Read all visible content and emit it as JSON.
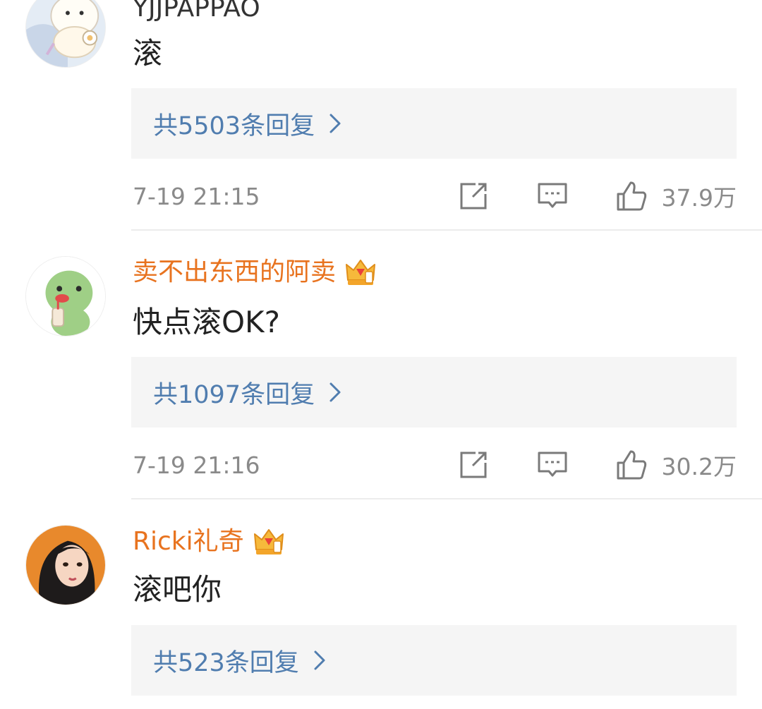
{
  "colors": {
    "username_top": "#333333",
    "username_vip": "#e8731f",
    "reply_link": "#507daf",
    "meta_text": "#8a8a8a",
    "reply_box_bg": "#f5f5f5"
  },
  "comments": [
    {
      "username": "YJJPAPPAO",
      "text": "滚",
      "replies_label": "共5503条回复",
      "time": "7-19 21:15",
      "likes": "37.9万",
      "avatar_icon": "cartoon-bear-avatar",
      "has_crown": false
    },
    {
      "username": "卖不出东西的阿卖",
      "text": "快点滚OK?",
      "replies_label": "共1097条回复",
      "time": "7-19 21:16",
      "likes": "30.2万",
      "avatar_icon": "green-frog-avatar",
      "has_crown": true,
      "crown_icon": "vip-crown-icon"
    },
    {
      "username": "Ricki礼奇",
      "text": "滚吧你",
      "replies_label": "共523条回复",
      "avatar_icon": "girl-portrait-avatar",
      "has_crown": true,
      "crown_icon": "vip-crown-icon"
    }
  ]
}
